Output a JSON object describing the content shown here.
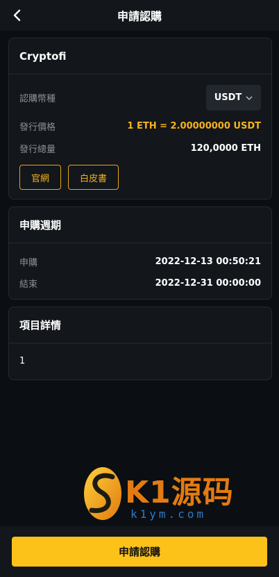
{
  "header": {
    "title": "申請認購",
    "back_icon": "chevron-left-icon"
  },
  "project": {
    "name": "Cryptofi",
    "currency_label": "認購幣種",
    "currency_value": "USDT",
    "price_label": "發行價格",
    "price_value": "1 ETH = 2.00000000 USDT",
    "total_label": "發行總量",
    "total_value": "120,0000 ETH",
    "website_button": "官網",
    "whitepaper_button": "白皮書"
  },
  "period": {
    "title": "申購週期",
    "start_label": "申購",
    "start_value": "2022-12-13 00:50:21",
    "end_label": "結束",
    "end_value": "2022-12-31 00:00:00"
  },
  "details": {
    "title": "項目詳情",
    "content": "1"
  },
  "watermark": {
    "brand": "K1源码",
    "url": "k1ym.com"
  },
  "footer": {
    "submit_label": "申請認購"
  },
  "colors": {
    "accent": "#fcc21a",
    "gold_text": "#f5b31b",
    "background": "#0b0f13",
    "card": "#13161b"
  }
}
